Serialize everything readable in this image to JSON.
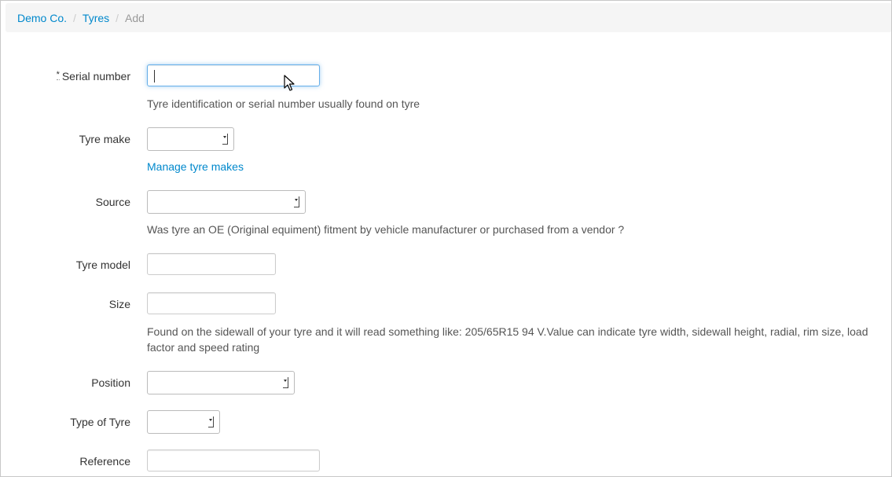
{
  "breadcrumb": {
    "items": [
      "Demo Co.",
      "Tyres"
    ],
    "current": "Add",
    "separator": "/"
  },
  "form": {
    "serial_number": {
      "required_marker": "*",
      "label": "Serial number",
      "value": "",
      "help": "Tyre identification or serial number usually found on tyre"
    },
    "tyre_make": {
      "label": "Tyre make",
      "selected": "",
      "manage_link": "Manage tyre makes"
    },
    "source": {
      "label": "Source",
      "selected": "",
      "help": "Was tyre an OE (Original equiment) fitment by vehicle manufacturer or purchased from a vendor ?"
    },
    "tyre_model": {
      "label": "Tyre model",
      "value": ""
    },
    "size": {
      "label": "Size",
      "value": "",
      "help_line1": "Found on the sidewall of your tyre and it will read something like: 205/65R15 94 V.Value can indicate tyre width, sidewall height, radial, rim size, load",
      "help_line2": "factor and speed rating"
    },
    "position": {
      "label": "Position",
      "selected": ""
    },
    "type_of_tyre": {
      "label": "Type of Tyre",
      "selected": ""
    },
    "reference": {
      "label": "Reference",
      "value": ""
    }
  },
  "colors": {
    "link": "#0088cc",
    "focus": "#66afe9"
  }
}
